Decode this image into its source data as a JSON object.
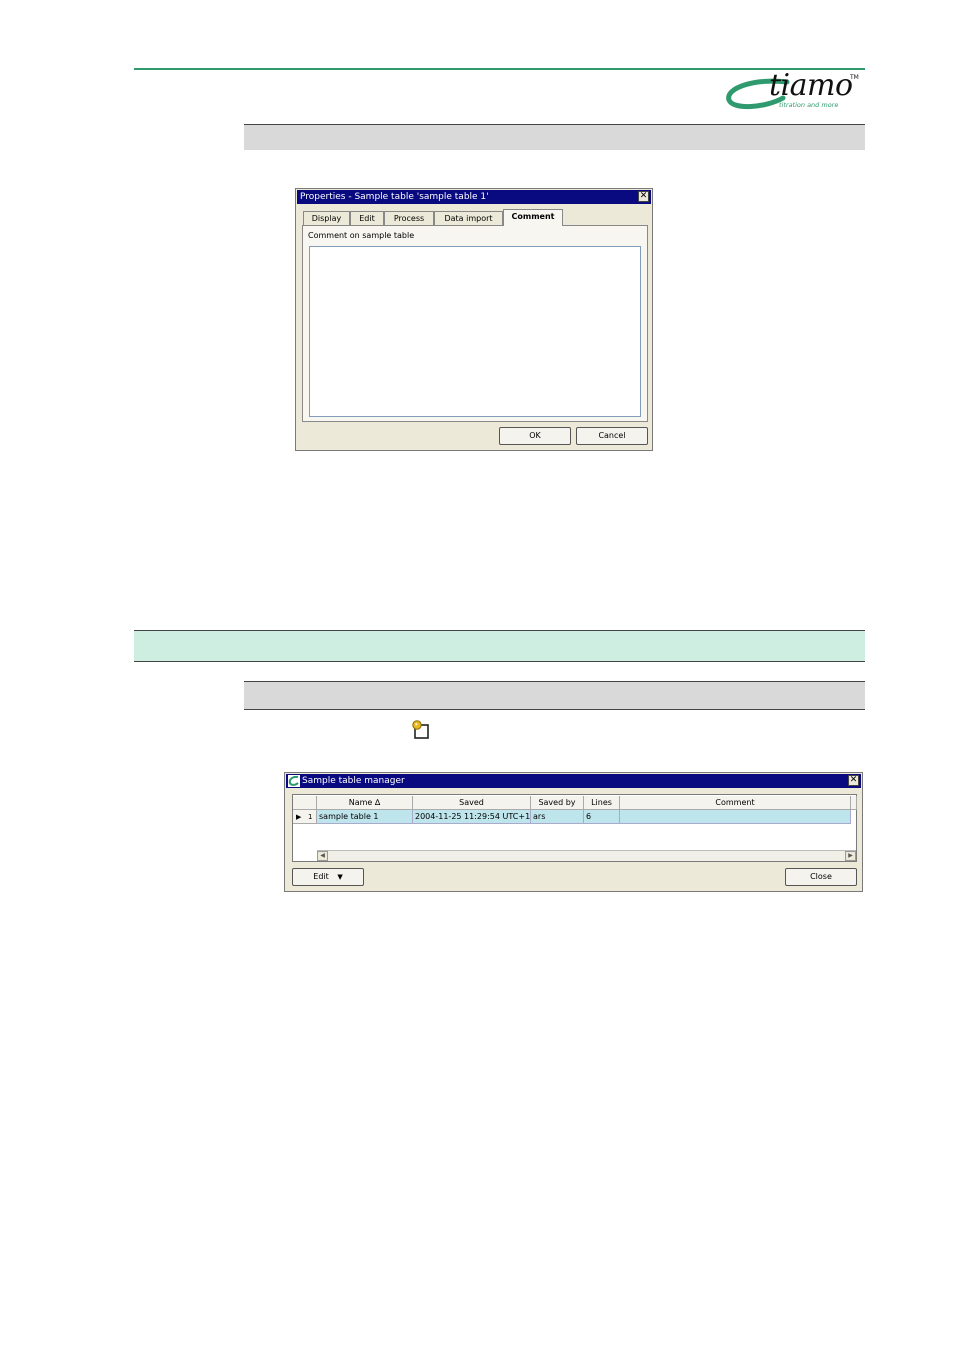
{
  "logo": {
    "word": "tiamo",
    "tm": "TM",
    "tagline": "titration and more",
    "color": "#2e9a6e"
  },
  "properties_dialog": {
    "title": "Properties - Sample table 'sample table 1'",
    "tabs": [
      "Display",
      "Edit",
      "Process",
      "Data import",
      "Comment"
    ],
    "active_tab": "Comment",
    "comment_label": "Comment on sample table",
    "comment_value": "",
    "ok_label": "OK",
    "cancel_label": "Cancel"
  },
  "manager_window": {
    "title": "Sample table manager",
    "columns": [
      "Name ∆",
      "Saved",
      "Saved by",
      "Lines",
      "Comment"
    ],
    "rows": [
      {
        "index": "1",
        "name": "sample table 1",
        "saved": "2004-11-25 11:29:54 UTC+1",
        "saved_by": "ars",
        "lines": "6",
        "comment": ""
      }
    ],
    "edit_label": "Edit",
    "close_label": "Close",
    "selected_row_color": "#bfe5ec"
  }
}
